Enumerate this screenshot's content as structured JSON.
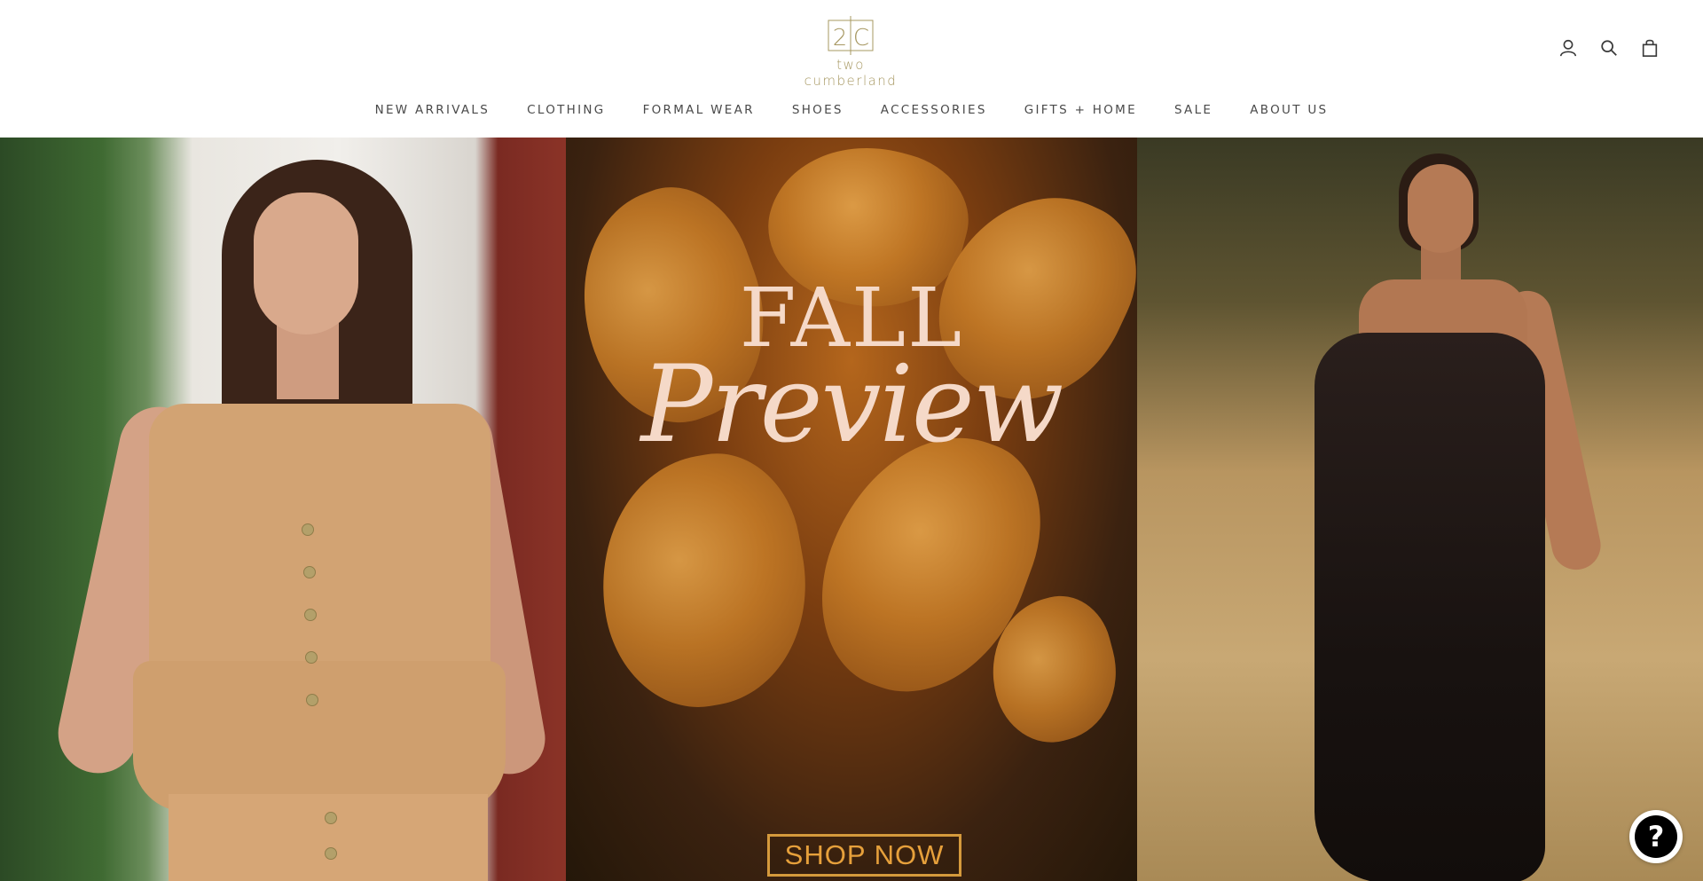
{
  "brand": {
    "mark": "2C",
    "name": "two cumberland",
    "color": "#a79862"
  },
  "header_icons": [
    {
      "name": "account-icon"
    },
    {
      "name": "search-icon"
    },
    {
      "name": "cart-icon"
    }
  ],
  "nav": {
    "items": [
      {
        "label": "NEW ARRIVALS"
      },
      {
        "label": "CLOTHING"
      },
      {
        "label": "FORMAL WEAR"
      },
      {
        "label": "SHOES"
      },
      {
        "label": "ACCESSORIES"
      },
      {
        "label": "GIFTS + HOME"
      },
      {
        "label": "SALE"
      },
      {
        "label": "ABOUT US"
      }
    ]
  },
  "hero": {
    "title_line1": "FALL",
    "title_line2": "Preview",
    "cta_label": "SHOP NOW",
    "cta_color": "#d59a3c",
    "title_color": "#f5d9c8"
  },
  "help": {
    "glyph": "?"
  }
}
